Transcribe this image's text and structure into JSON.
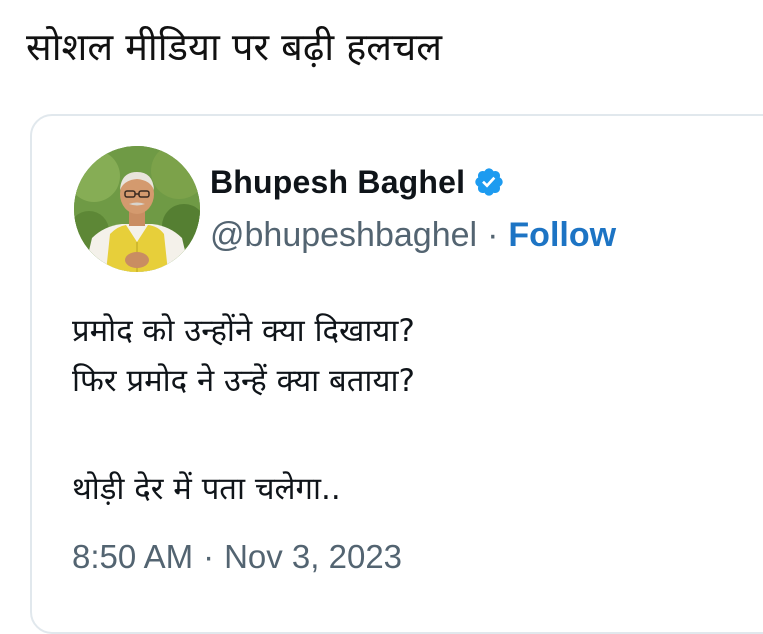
{
  "headline": "सोशल मीडिया पर बढ़ी हलचल",
  "tweet": {
    "author": {
      "display_name": "Bhupesh Baghel",
      "handle": "@bhupeshbaghel",
      "verified": true,
      "verified_icon": "verified-badge-icon",
      "avatar_icon": "profile-photo"
    },
    "separator": "·",
    "follow_label": "Follow",
    "text_lines": [
      "प्रमोद को उन्होंने क्या दिखाया?",
      "फिर प्रमोद ने उन्हें क्या बताया?",
      "",
      "थोड़ी देर में पता चलेगा.."
    ],
    "time": "8:50 AM",
    "date": "Nov 3, 2023",
    "colors": {
      "link": "#1d74c4",
      "verified": "#1d9bf0",
      "muted": "#536471"
    }
  }
}
